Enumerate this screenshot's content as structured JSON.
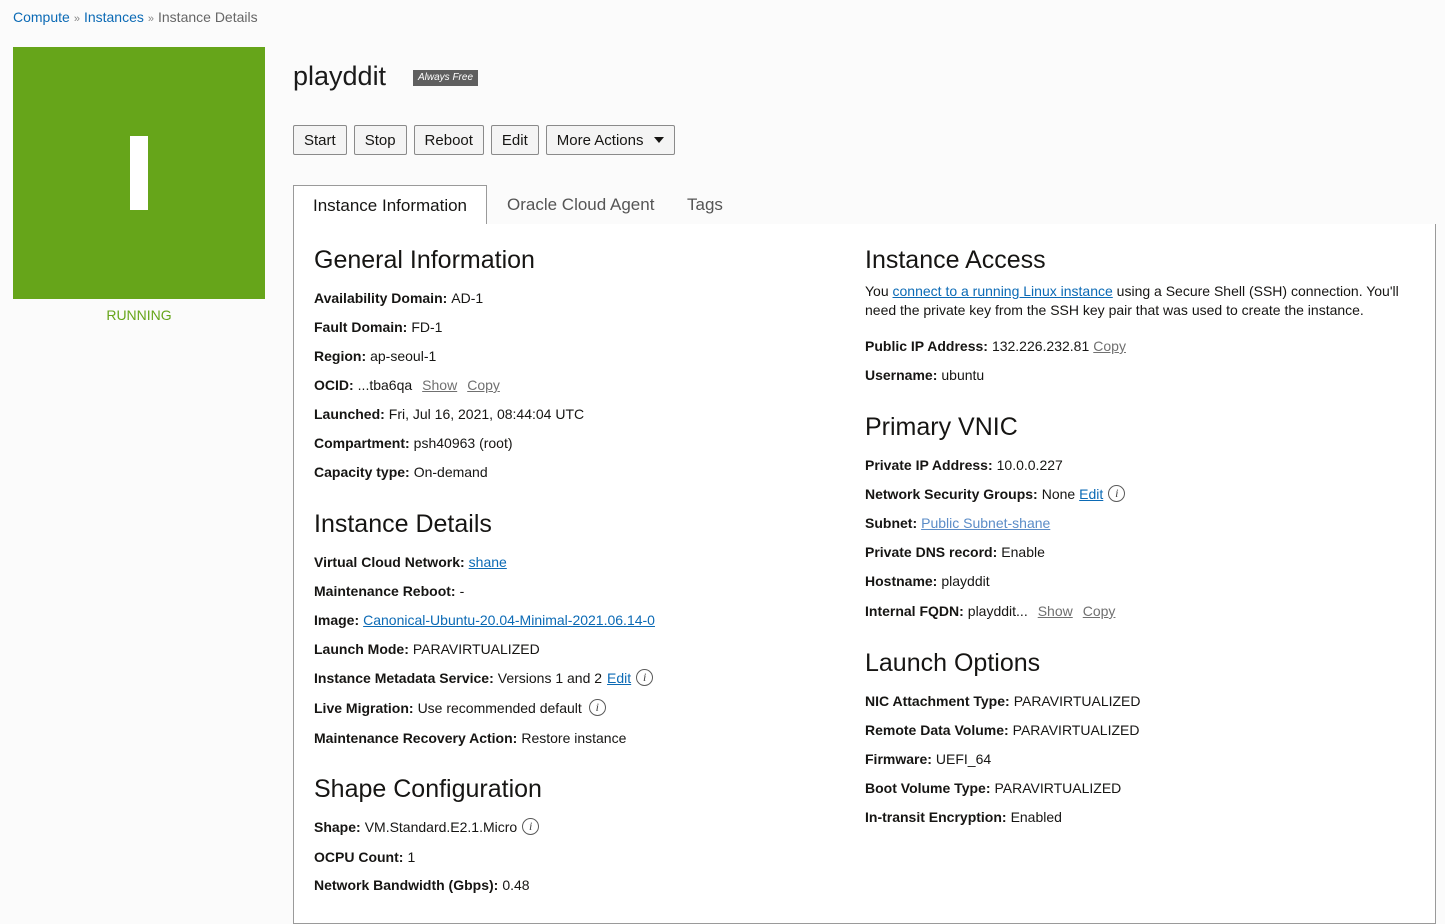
{
  "breadcrumb": {
    "items": [
      "Compute",
      "Instances",
      "Instance Details"
    ],
    "separator": "»"
  },
  "instance": {
    "tile_letter": "I",
    "state": "RUNNING",
    "name": "playddit",
    "badge": "Always Free",
    "tile_color": "#66a51a"
  },
  "actions": {
    "start": "Start",
    "stop": "Stop",
    "reboot": "Reboot",
    "edit": "Edit",
    "more": "More Actions"
  },
  "tabs": [
    "Instance Information",
    "Oracle Cloud Agent",
    "Tags"
  ],
  "general": {
    "title": "General Information",
    "availability_domain": {
      "label": "Availability Domain:",
      "value": "AD-1"
    },
    "fault_domain": {
      "label": "Fault Domain:",
      "value": "FD-1"
    },
    "region": {
      "label": "Region:",
      "value": "ap-seoul-1"
    },
    "ocid": {
      "label": "OCID:",
      "value": "...tba6qa",
      "show": "Show",
      "copy": "Copy"
    },
    "launched": {
      "label": "Launched:",
      "value": "Fri, Jul 16, 2021, 08:44:04 UTC"
    },
    "compartment": {
      "label": "Compartment:",
      "value": "psh40963 (root)"
    },
    "capacity": {
      "label": "Capacity type:",
      "value": "On-demand"
    }
  },
  "details": {
    "title": "Instance Details",
    "vcn": {
      "label": "Virtual Cloud Network:",
      "value": "shane"
    },
    "maintenance_reboot": {
      "label": "Maintenance Reboot:",
      "value": "-"
    },
    "image": {
      "label": "Image:",
      "value": "Canonical-Ubuntu-20.04-Minimal-2021.06.14-0"
    },
    "launch_mode": {
      "label": "Launch Mode:",
      "value": "PARAVIRTUALIZED"
    },
    "metadata": {
      "label": "Instance Metadata Service:",
      "value": "Versions 1 and 2",
      "edit": "Edit"
    },
    "live_migration": {
      "label": "Live Migration:",
      "value": "Use recommended default"
    },
    "recovery": {
      "label": "Maintenance Recovery Action:",
      "value": "Restore instance"
    }
  },
  "shape": {
    "title": "Shape Configuration",
    "shape": {
      "label": "Shape:",
      "value": "VM.Standard.E2.1.Micro"
    },
    "ocpu": {
      "label": "OCPU Count:",
      "value": "1"
    },
    "bandwidth": {
      "label": "Network Bandwidth (Gbps):",
      "value": "0.48"
    }
  },
  "access": {
    "title": "Instance Access",
    "text_before": "You ",
    "link": "connect to a running Linux instance",
    "text_after": " using a Secure Shell (SSH) connection. You'll need the private key from the SSH key pair that was used to create the instance.",
    "public_ip": {
      "label": "Public IP Address:",
      "value": "132.226.232.81",
      "copy": "Copy"
    },
    "username": {
      "label": "Username:",
      "value": "ubuntu"
    }
  },
  "vnic": {
    "title": "Primary VNIC",
    "private_ip": {
      "label": "Private IP Address:",
      "value": "10.0.0.227"
    },
    "nsg": {
      "label": "Network Security Groups:",
      "value": "None",
      "edit": "Edit"
    },
    "subnet": {
      "label": "Subnet:",
      "value": "Public Subnet-shane"
    },
    "dns": {
      "label": "Private DNS record:",
      "value": "Enable"
    },
    "hostname": {
      "label": "Hostname:",
      "value": "playddit"
    },
    "fqdn": {
      "label": "Internal FQDN:",
      "value": "playddit...",
      "show": "Show",
      "copy": "Copy"
    }
  },
  "launch": {
    "title": "Launch Options",
    "nic": {
      "label": "NIC Attachment Type:",
      "value": "PARAVIRTUALIZED"
    },
    "remote": {
      "label": "Remote Data Volume:",
      "value": "PARAVIRTUALIZED"
    },
    "firmware": {
      "label": "Firmware:",
      "value": "UEFI_64"
    },
    "boot": {
      "label": "Boot Volume Type:",
      "value": "PARAVIRTUALIZED"
    },
    "encryption": {
      "label": "In-transit Encryption:",
      "value": "Enabled"
    }
  }
}
